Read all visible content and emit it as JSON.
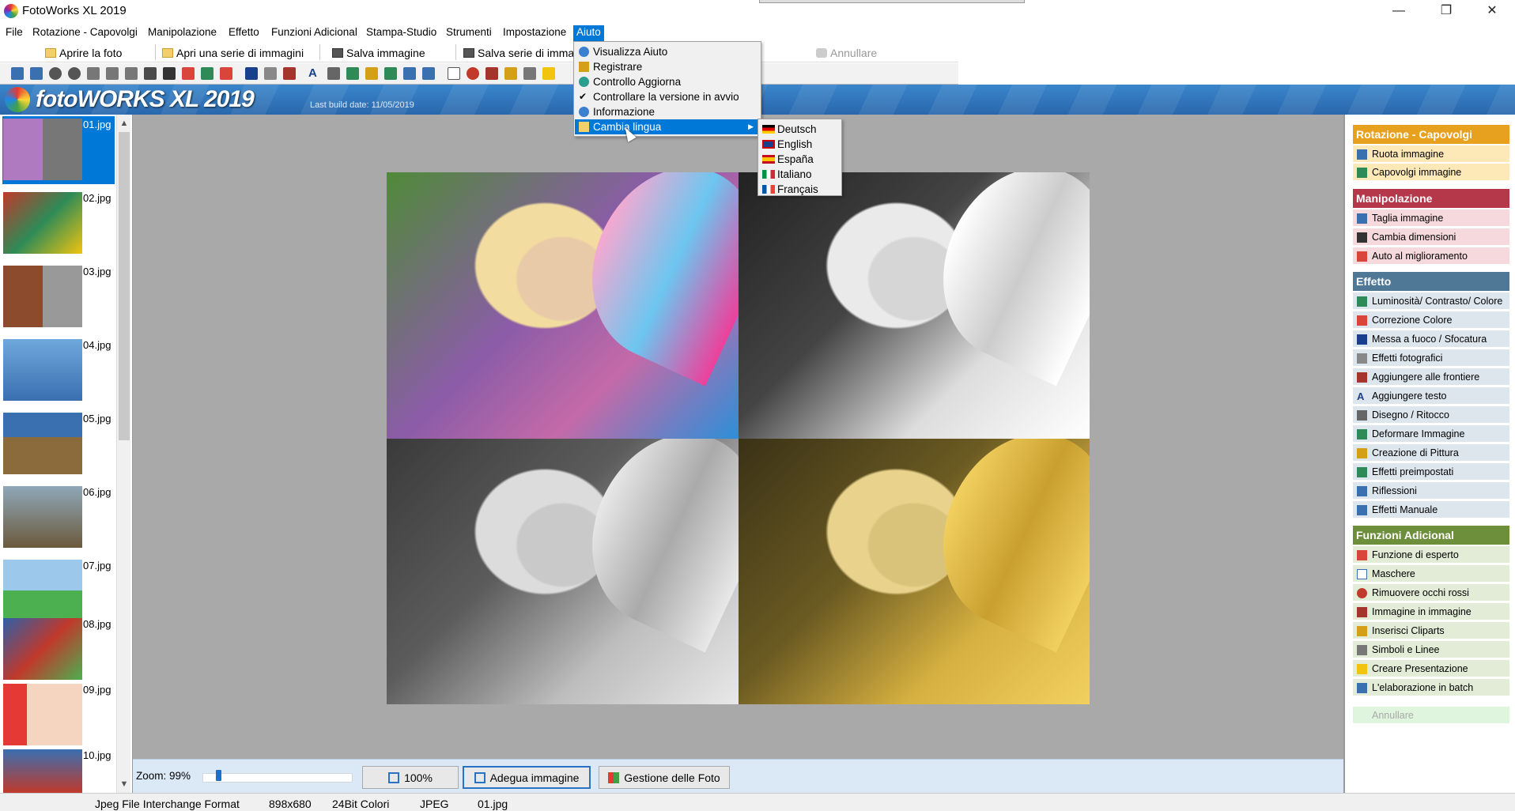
{
  "window": {
    "title": "FotoWorks XL 2019",
    "minimize": "—",
    "maximize": "❐",
    "close": "✕"
  },
  "menubar": {
    "items": [
      "File",
      "Rotazione - Capovolgi",
      "Manipolazione",
      "Effetto",
      "Funzioni Adicional",
      "Stampa-Studio",
      "Strumenti",
      "Impostazione",
      "Aiuto"
    ]
  },
  "toolbar1": {
    "open_photo": "Aprire la foto",
    "open_series": "Apri una serie di immagini",
    "save_image": "Salva immagine",
    "save_series": "Salva serie di imma",
    "undo": "Annullare"
  },
  "banner": {
    "logo": "fotoWORKS XL 2019",
    "build_date": "Last build date: 11/05/2019"
  },
  "thumbnails": [
    "01.jpg",
    "02.jpg",
    "03.jpg",
    "04.jpg",
    "05.jpg",
    "06.jpg",
    "07.jpg",
    "08.jpg",
    "09.jpg",
    "10.jpg"
  ],
  "aiuto_menu": {
    "items": [
      {
        "label": "Visualizza Aiuto",
        "icon": "help-icon"
      },
      {
        "label": "Registrare",
        "icon": "lock-icon"
      },
      {
        "label": "Controllo Aggiorna",
        "icon": "globe-icon"
      },
      {
        "label": "Controllare la versione in avvio",
        "icon": "check-icon"
      },
      {
        "label": "Informazione",
        "icon": "info-icon"
      },
      {
        "label": "Cambia lingua",
        "icon": "language-icon"
      }
    ]
  },
  "language_menu": {
    "items": [
      {
        "label": "Deutsch",
        "flag": "german-flag-icon"
      },
      {
        "label": "English",
        "flag": "uk-flag-icon"
      },
      {
        "label": "España",
        "flag": "spain-flag-icon"
      },
      {
        "label": "Italiano",
        "flag": "italy-flag-icon"
      },
      {
        "label": "Français",
        "flag": "france-flag-icon"
      }
    ]
  },
  "zoom": {
    "label": "Zoom: 99%",
    "btn_100": "100%",
    "btn_fit": "Adegua immagine",
    "btn_manage": "Gestione delle Foto",
    "level": 0.99
  },
  "right_panel": {
    "rotation": {
      "header": "Rotazione - Capovolgi",
      "color": "#e8a11e",
      "item_bg": "#fde9b8",
      "items": [
        "Ruota immagine",
        "Capovolgi immagine"
      ]
    },
    "manipulation": {
      "header": "Manipolazione",
      "color": "#b5374a",
      "item_bg": "#f5d9dc",
      "items": [
        "Taglia immagine",
        "Cambia dimensioni",
        "Auto al miglioramento"
      ]
    },
    "effect": {
      "header": "Effetto",
      "color": "#4e7896",
      "item_bg": "#dde6ed",
      "items": [
        "Luminosità/ Contrasto/ Colore",
        "Correzione Colore",
        "Messa a fuoco / Sfocatura",
        "Effetti fotografici",
        "Aggiungere alle frontiere",
        "Aggiungere testo",
        "Disegno / Ritocco",
        "Deformare Immagine",
        "Creazione di Pittura",
        "Effetti preimpostati",
        "Riflessioni",
        "Effetti Manuale"
      ]
    },
    "functions": {
      "header": "Funzioni Adicional",
      "color": "#6d8f3c",
      "item_bg": "#e3ecd7",
      "items": [
        "Funzione di esperto",
        "Maschere",
        "Rimuovere occhi rossi",
        "Immagine in immagine",
        "Inserisci Cliparts",
        "Simboli e Linee",
        "Creare Presentazione",
        "L'elaborazione in batch"
      ]
    },
    "undo": "Annullare"
  },
  "statusbar": {
    "format": "Jpeg File Interchange Format",
    "dimensions": "898x680",
    "colors": "24Bit Colori",
    "type": "JPEG",
    "file": "01.jpg"
  }
}
